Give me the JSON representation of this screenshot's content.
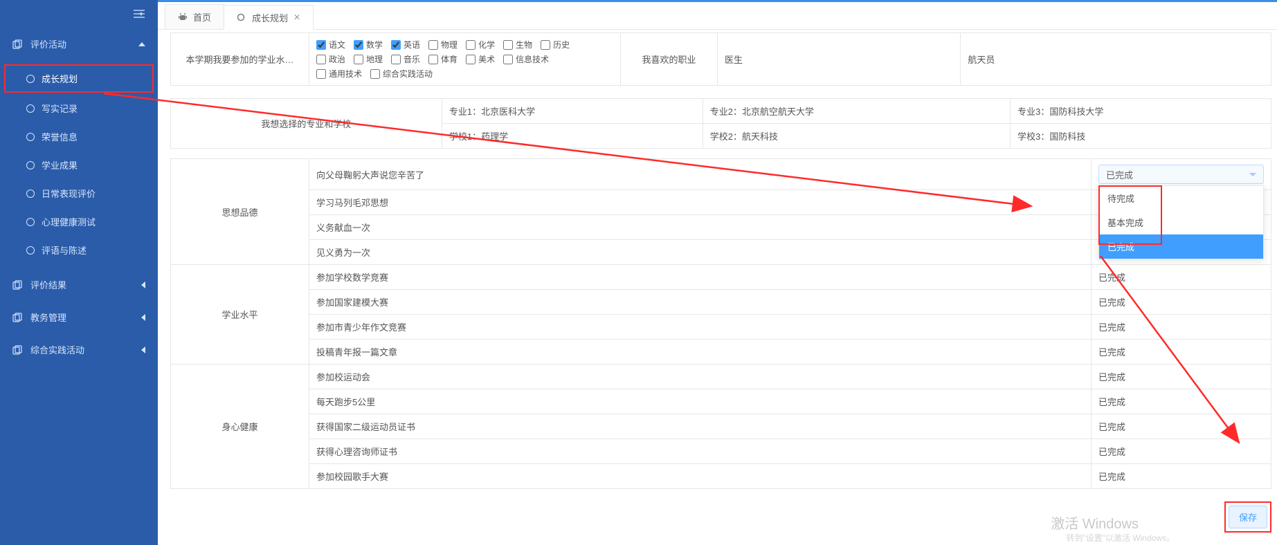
{
  "sidebar": {
    "collapse_icon": "collapse",
    "groups": [
      {
        "label": "评价活动",
        "expanded": true,
        "items": [
          {
            "label": "成长规划",
            "active": true
          },
          {
            "label": "写实记录"
          },
          {
            "label": "荣誉信息"
          },
          {
            "label": "学业成果"
          },
          {
            "label": "日常表现评价"
          },
          {
            "label": "心理健康测试"
          },
          {
            "label": "评语与陈述"
          }
        ]
      },
      {
        "label": "评价结果",
        "expanded": false
      },
      {
        "label": "教务管理",
        "expanded": false
      },
      {
        "label": "综合实践活动",
        "expanded": false
      }
    ]
  },
  "tabs": [
    {
      "label": "首页",
      "icon": "android"
    },
    {
      "label": "成长规划",
      "icon": "circle",
      "active": true,
      "closable": true
    }
  ],
  "section_subjects": {
    "label": "本学期我要参加的学业水…",
    "row1": [
      {
        "label": "语文",
        "checked": true
      },
      {
        "label": "数学",
        "checked": true
      },
      {
        "label": "英语",
        "checked": true
      },
      {
        "label": "物理",
        "checked": false
      },
      {
        "label": "化学",
        "checked": false
      },
      {
        "label": "生物",
        "checked": false
      },
      {
        "label": "历史",
        "checked": false
      }
    ],
    "row2": [
      {
        "label": "政治",
        "checked": false
      },
      {
        "label": "地理",
        "checked": false
      },
      {
        "label": "音乐",
        "checked": false
      },
      {
        "label": "体育",
        "checked": false
      },
      {
        "label": "美术",
        "checked": false
      },
      {
        "label": "信息技术",
        "checked": false
      }
    ],
    "row3": [
      {
        "label": "通用技术",
        "checked": false
      },
      {
        "label": "综合实践活动",
        "checked": false
      }
    ]
  },
  "career": {
    "label": "我喜欢的职业",
    "value1": "医生",
    "value2": "航天员"
  },
  "majors": {
    "label": "我想选择的专业和学校",
    "row_majors": [
      {
        "k": "专业1：",
        "v": "北京医科大学"
      },
      {
        "k": "专业2：",
        "v": "北京航空航天大学"
      },
      {
        "k": "专业3：",
        "v": "国防科技大学"
      }
    ],
    "row_schools": [
      {
        "k": "学校1：",
        "v": "药理学"
      },
      {
        "k": "学校2：",
        "v": "航天科技"
      },
      {
        "k": "学校3：",
        "v": "国防科技"
      }
    ]
  },
  "dropdown": {
    "selected": "已完成",
    "options": [
      "待完成",
      "基本完成",
      "已完成"
    ]
  },
  "groups": [
    {
      "name": "思想品德",
      "rows": [
        {
          "text": "向父母鞠躬大声说您辛苦了",
          "status_dropdown": true
        },
        {
          "text": "学习马列毛邓思想"
        },
        {
          "text": "义务献血一次"
        },
        {
          "text": "见义勇为一次"
        }
      ]
    },
    {
      "name": "学业水平",
      "rows": [
        {
          "text": "参加学校数学竞赛",
          "status": "已完成"
        },
        {
          "text": "参加国家建模大赛",
          "status": "已完成"
        },
        {
          "text": "参加市青少年作文竞赛",
          "status": "已完成"
        },
        {
          "text": "投稿青年报一篇文章",
          "status": "已完成"
        }
      ]
    },
    {
      "name": "身心健康",
      "rows": [
        {
          "text": "参加校运动会",
          "status": "已完成"
        },
        {
          "text": "每天跑步5公里",
          "status": "已完成"
        },
        {
          "text": "获得国家二级运动员证书",
          "status": "已完成"
        },
        {
          "text": "获得心理咨询师证书",
          "status": "已完成"
        },
        {
          "text": "参加校园歌手大赛",
          "status": "已完成"
        }
      ]
    }
  ],
  "save_label": "保存",
  "watermark": "激活 Windows",
  "watermark_sub": "转到\"设置\"以激活 Windows。"
}
